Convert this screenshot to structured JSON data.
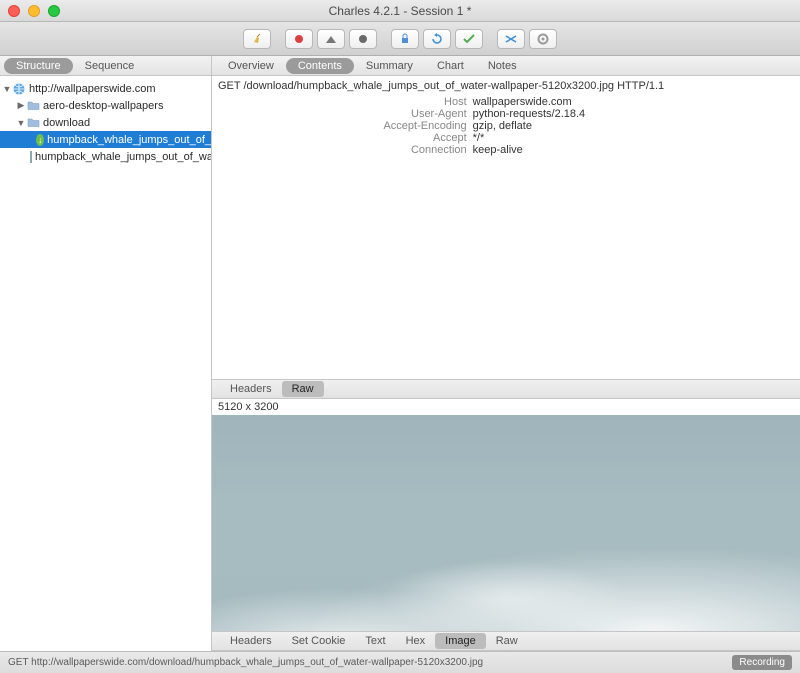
{
  "window": {
    "title": "Charles 4.2.1 - Session 1 *"
  },
  "toolbar": {
    "icons": [
      "broom",
      "record",
      "pause",
      "stop",
      "shield",
      "refresh",
      "check",
      "shuffle",
      "gear"
    ]
  },
  "sidebarTabs": {
    "structure": "Structure",
    "sequence": "Sequence"
  },
  "tree": {
    "host": "http://wallpaperswide.com",
    "folder1": "aero-desktop-wallpapers",
    "folder2": "download",
    "item_sel": "humpback_whale_jumps_out_of_",
    "item2": "humpback_whale_jumps_out_of_wat"
  },
  "upperTabs": {
    "overview": "Overview",
    "contents": "Contents",
    "summary": "Summary",
    "chart": "Chart",
    "notes": "Notes"
  },
  "request": {
    "line": "GET /download/humpback_whale_jumps_out_of_water-wallpaper-5120x3200.jpg HTTP/1.1",
    "headers": {
      "k_host": "Host",
      "v_host": "wallpaperswide.com",
      "k_ua": "User-Agent",
      "v_ua": "python-requests/2.18.4",
      "k_ae": "Accept-Encoding",
      "v_ae": "gzip, deflate",
      "k_ac": "Accept",
      "v_ac": "*/*",
      "k_cn": "Connection",
      "v_cn": "keep-alive"
    }
  },
  "reqTabs": {
    "headers": "Headers",
    "raw": "Raw"
  },
  "imageDim": "5120 x 3200",
  "respTabs": {
    "headers": "Headers",
    "setcookie": "Set Cookie",
    "text": "Text",
    "hex": "Hex",
    "image": "Image",
    "raw": "Raw"
  },
  "status": {
    "text": "GET http://wallpaperswide.com/download/humpback_whale_jumps_out_of_water-wallpaper-5120x3200.jpg",
    "recording": "Recording"
  }
}
